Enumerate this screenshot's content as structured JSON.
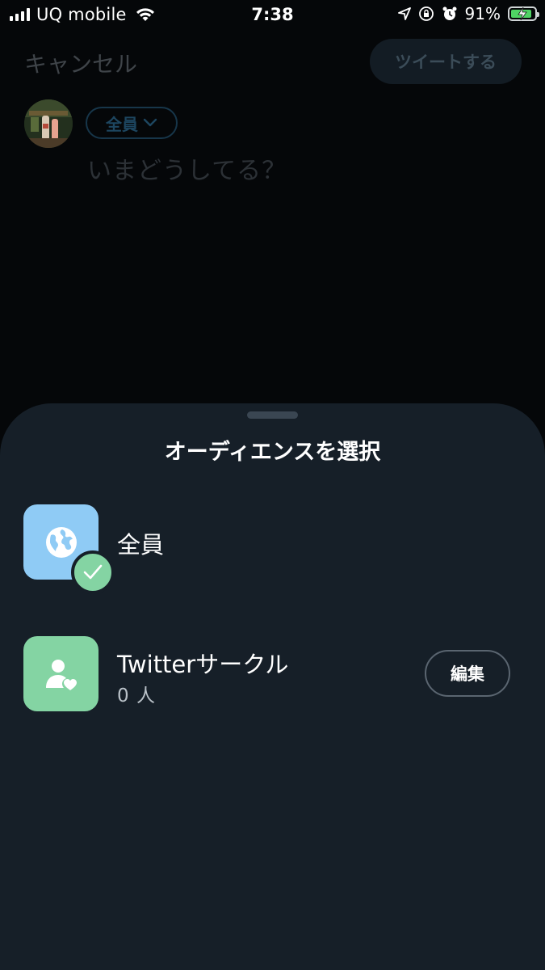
{
  "status_bar": {
    "carrier": "UQ mobile",
    "time": "7:38",
    "battery_percent": "91%",
    "battery_level": 0.91,
    "battery_color": "#4fd364",
    "icons": [
      "signal-icon",
      "wifi-icon",
      "location-arrow-icon",
      "orientation-lock-icon",
      "alarm-icon",
      "battery-charging-icon"
    ]
  },
  "compose": {
    "cancel_label": "キャンセル",
    "tweet_button_label": "ツイートする",
    "audience_pill_label": "全員",
    "placeholder": "いまどうしてる？"
  },
  "sheet": {
    "title": "オーディエンスを選択",
    "options": [
      {
        "label": "全員",
        "icon": "globe-icon",
        "icon_color": "#8fcbf5",
        "selected": true
      },
      {
        "label": "Twitterサークル",
        "sub": "0 人",
        "icon": "person-heart-icon",
        "icon_color": "#84d4a3",
        "edit_label": "編集"
      }
    ]
  },
  "colors": {
    "background": "#050709",
    "sheet": "#161f28",
    "accent_green": "#84d4a3",
    "accent_blue": "#8fcbf5"
  }
}
